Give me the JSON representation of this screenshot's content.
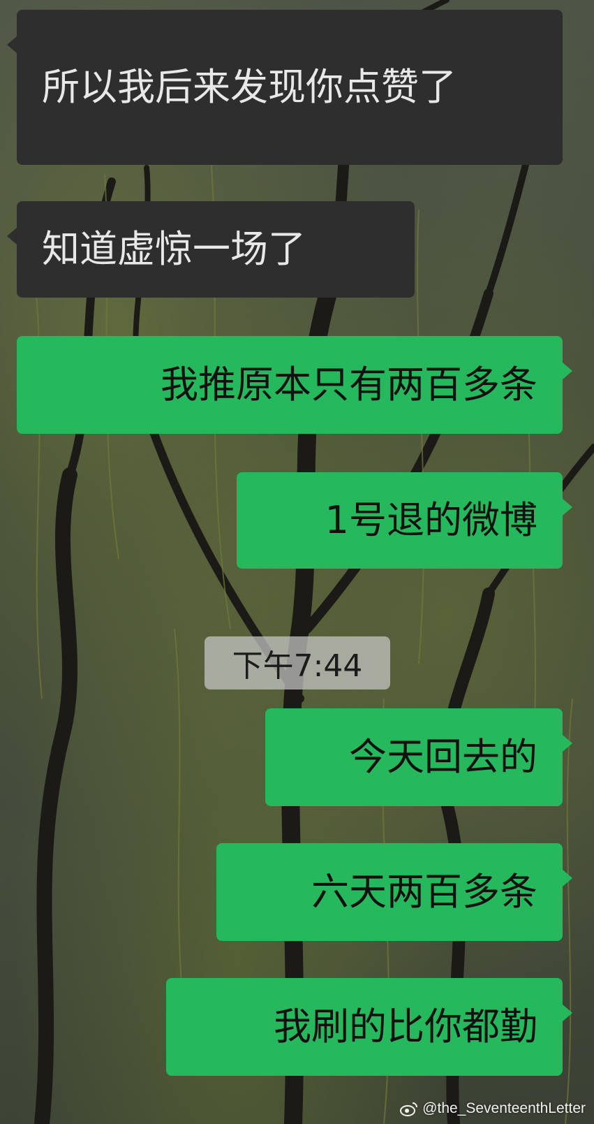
{
  "messages": [
    {
      "side": "in",
      "text": "所以我后来发现你点赞了"
    },
    {
      "side": "in",
      "text": "知道虚惊一场了"
    },
    {
      "side": "out",
      "text": "我推原本只有两百多条"
    },
    {
      "side": "out",
      "text": "1号退的微博"
    },
    {
      "side": "out",
      "text": "今天回去的"
    },
    {
      "side": "out",
      "text": "六天两百多条"
    },
    {
      "side": "out",
      "text": "我刷的比你都勤"
    }
  ],
  "timestamp": "下午7:44",
  "watermark": {
    "icon": "weibo-icon",
    "text": "@the_SeventeenthLetter"
  },
  "colors": {
    "incoming_bubble": "#2e2e2e",
    "outgoing_bubble": "#26b85c"
  }
}
